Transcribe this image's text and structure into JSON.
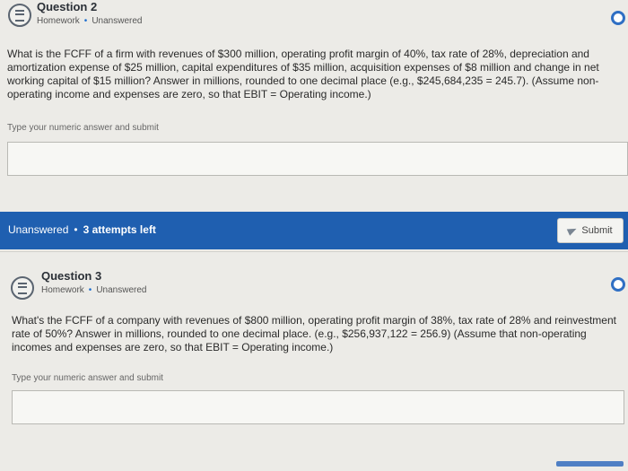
{
  "question2": {
    "title": "Question 2",
    "type": "Homework",
    "status": "Unanswered",
    "text": "What is the FCFF of a firm with revenues of $300 million, operating profit margin of 40%, tax rate of 28%, depreciation and amortization expense of $25 million, capital expenditures of $35 million, acquisition expenses of $8 million and change in net working capital of $15 million? Answer in millions, rounded to one decimal place (e.g., $245,684,235 = 245.7). (Assume non-operating income and expenses are zero, so that EBIT = Operating income.)",
    "hint": "Type your numeric answer and submit",
    "answer_value": ""
  },
  "submit_bar": {
    "status": "Unanswered",
    "attempts": "3 attempts left",
    "submit_label": "Submit"
  },
  "question3": {
    "title": "Question 3",
    "type": "Homework",
    "status": "Unanswered",
    "text": "What's the FCFF of a company with revenues of $800 million, operating profit margin of 38%, tax rate of 28% and reinvestment rate of 50%? Answer in millions, rounded to one decimal place. (e.g., $256,937,122 = 256.9) (Assume that non-operating incomes and expenses are zero, so that EBIT = Operating income.)",
    "hint": "Type your numeric answer and submit",
    "answer_value": ""
  },
  "colors": {
    "accent": "#1f5fb0",
    "background": "#ecebe7"
  }
}
